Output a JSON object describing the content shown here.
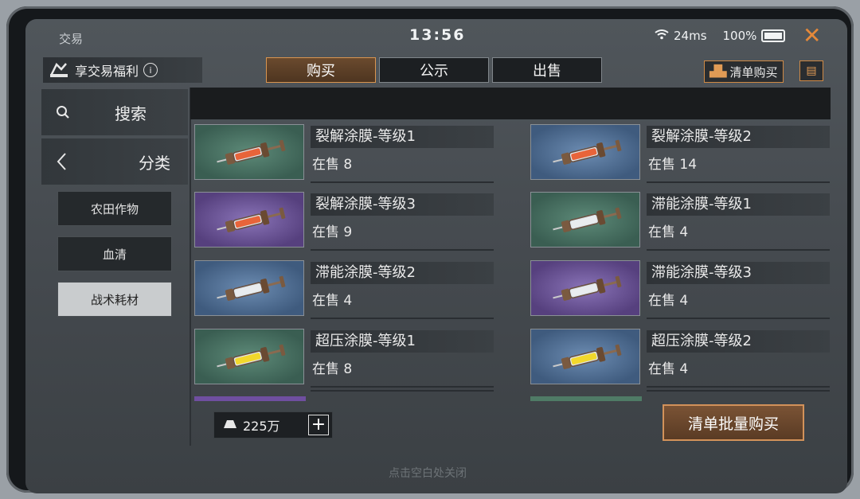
{
  "statusbar": {
    "title": "交易",
    "time": "13:56",
    "network": "24ms",
    "battery": "100%"
  },
  "perk": {
    "label": "享交易福利",
    "info": "i"
  },
  "tabs": [
    {
      "label": "购买",
      "active": true
    },
    {
      "label": "公示"
    },
    {
      "label": "出售"
    }
  ],
  "header_actions": {
    "list_buy_label": "清单购买"
  },
  "sidebar": {
    "search_label": "搜索",
    "category_label": "分类",
    "categories": [
      {
        "label": "农田作物"
      },
      {
        "label": "血清"
      },
      {
        "label": "战术耗材",
        "selected": true
      }
    ]
  },
  "items": [
    {
      "name": "裂解涂膜-等级1",
      "stock": "在售 8",
      "bg": "green",
      "liquid": "#e8643a"
    },
    {
      "name": "裂解涂膜-等级2",
      "stock": "在售 14",
      "bg": "blue",
      "liquid": "#e8643a"
    },
    {
      "name": "裂解涂膜-等级3",
      "stock": "在售 9",
      "bg": "purple",
      "liquid": "#e8643a"
    },
    {
      "name": "滞能涂膜-等级1",
      "stock": "在售 4",
      "bg": "green",
      "liquid": "#e9ecef"
    },
    {
      "name": "滞能涂膜-等级2",
      "stock": "在售 4",
      "bg": "blue",
      "liquid": "#e9ecef"
    },
    {
      "name": "滞能涂膜-等级3",
      "stock": "在售 4",
      "bg": "purple",
      "liquid": "#e9ecef"
    },
    {
      "name": "超压涂膜-等级1",
      "stock": "在售 8",
      "bg": "green",
      "liquid": "#f2d82c"
    },
    {
      "name": "超压涂膜-等级2",
      "stock": "在售 4",
      "bg": "blue",
      "liquid": "#f2d82c"
    }
  ],
  "footer": {
    "balance": "225万",
    "batch_buy_label": "清单批量购买",
    "close_hint": "点击空白处关闭"
  },
  "colors": {
    "accent": "#d99550",
    "close": "#e5893a"
  }
}
